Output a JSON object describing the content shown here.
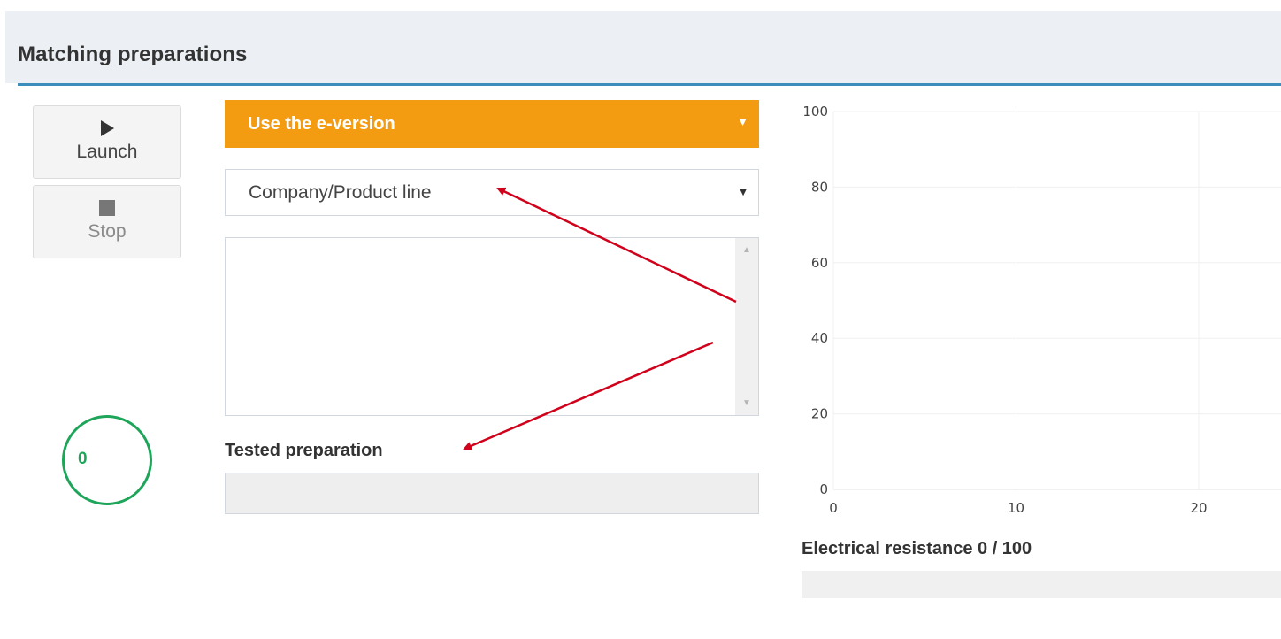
{
  "panel": {
    "title": "Matching preparations"
  },
  "controls": {
    "launch": {
      "label": "Launch",
      "icon": "play-icon"
    },
    "stop": {
      "label": "Stop",
      "icon": "stop-icon"
    }
  },
  "counter": {
    "value": "0",
    "color": "#1ea55a"
  },
  "version_select": {
    "value": "Use the e-version",
    "color": "#f39c12"
  },
  "company_select": {
    "value": "Company/Product line"
  },
  "tested_preparation": {
    "label": "Tested preparation",
    "value": ""
  },
  "resistance": {
    "label": "Electrical resistance 0 / 100",
    "value": 0,
    "max": 100
  },
  "chart_data": {
    "type": "scatter",
    "x_ticks": [
      "0",
      "10",
      "20"
    ],
    "y_ticks": [
      "100",
      "80",
      "60",
      "40",
      "20",
      "0"
    ],
    "xlim": [
      0,
      20
    ],
    "ylim": [
      0,
      100
    ],
    "grid": true,
    "series": []
  },
  "colors": {
    "accent": "#3c8dbc",
    "annotation_arrow": "#d0021b"
  }
}
